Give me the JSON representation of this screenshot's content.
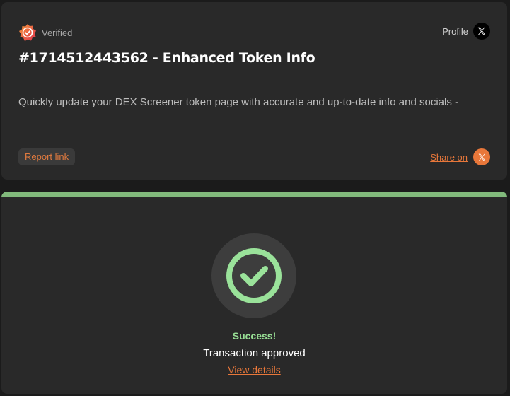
{
  "header": {
    "verified_label": "Verified",
    "profile_label": "Profile"
  },
  "main": {
    "title": "#1714512443562 - Enhanced Token Info",
    "description": "Quickly update your DEX Screener token page with accurate and up-to-date info and socials -"
  },
  "footer": {
    "report_label": "Report link",
    "share_label": "Share on"
  },
  "status": {
    "title": "Success!",
    "subtitle": "Transaction approved",
    "details_link": "View details"
  },
  "colors": {
    "accent": "#e8773a",
    "success": "#98df95",
    "success_bar": "#82ba7c",
    "card_bg": "#292929"
  },
  "icons": {
    "verified": "verified-badge-icon",
    "profile": "x-logo-icon",
    "share": "x-logo-icon",
    "status": "check-circle-icon"
  }
}
